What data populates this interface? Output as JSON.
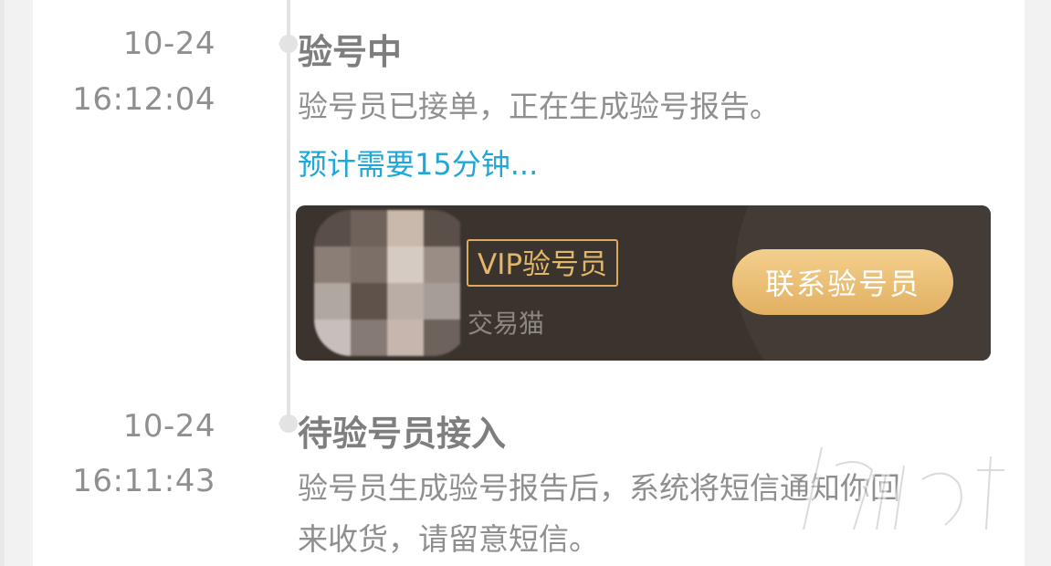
{
  "timeline": [
    {
      "date": "10-24",
      "time": "16:12:04",
      "title": "验号中",
      "description": "验号员已接单，正在生成验号报告。",
      "eta": "预计需要15分钟...",
      "inspector_card": {
        "badge": "VIP验号员",
        "subtitle": "交易猫",
        "contact_button": "联系验号员"
      }
    },
    {
      "date": "10-24",
      "time": "16:11:43",
      "title": "待验号员接入",
      "description_line1": "验号员生成验号报告后，系统将短信通知你回",
      "description_line2": "来收货，请留意短信。"
    }
  ],
  "colors": {
    "card_background": "#3a332e",
    "badge_gold": "#e3b76a",
    "button_gold": "#e2b062",
    "link_blue": "#1fa7d8",
    "timeline_gray": "#e3e3e3"
  }
}
